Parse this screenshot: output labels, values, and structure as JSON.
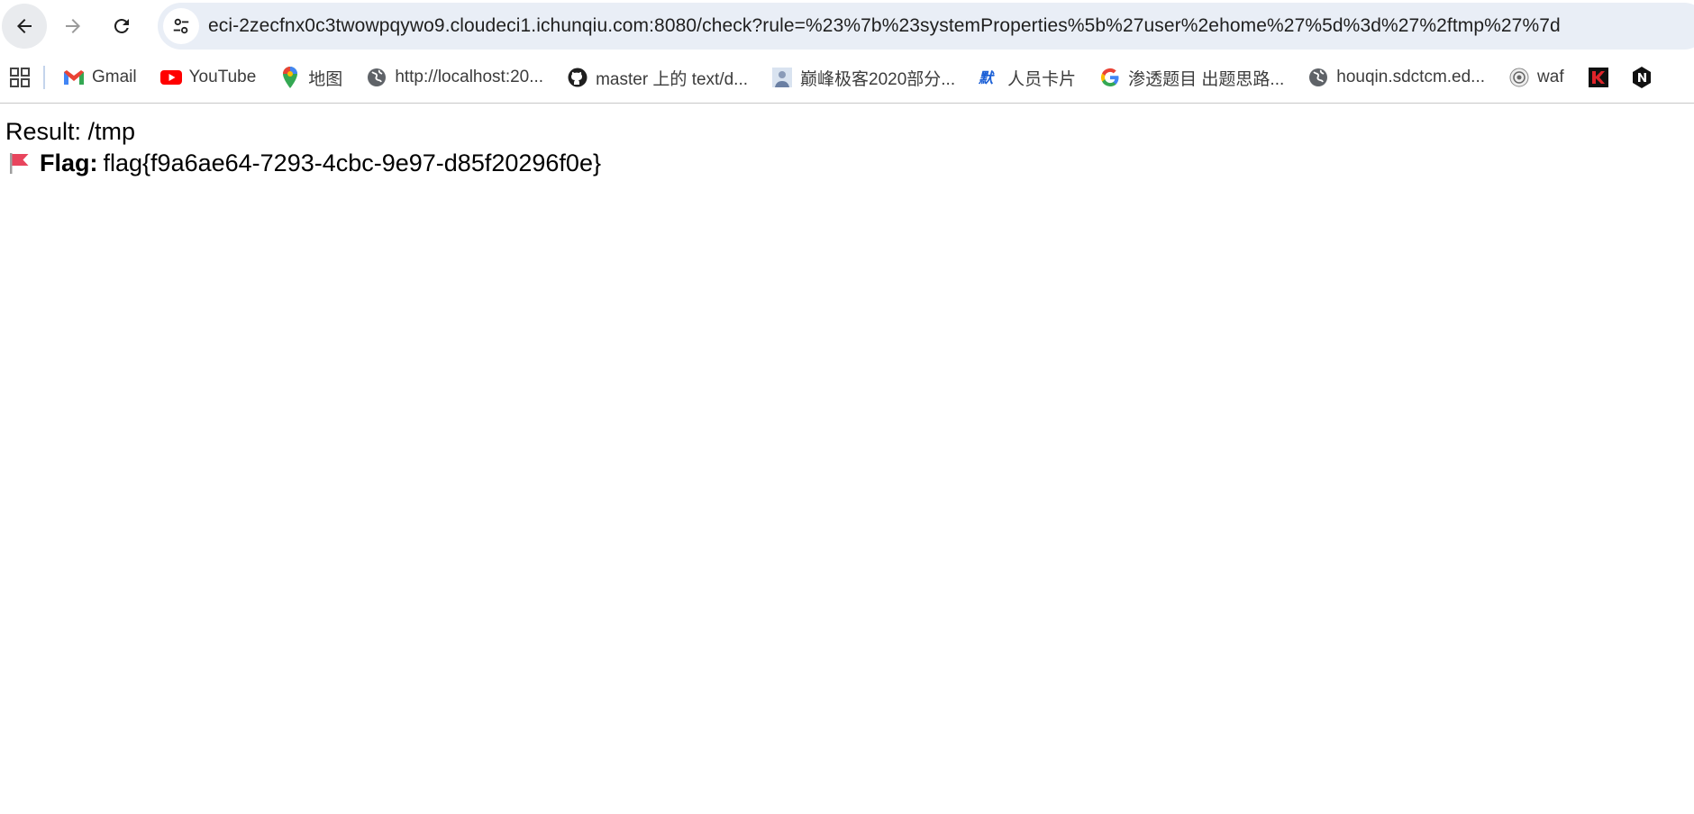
{
  "browser": {
    "url": "eci-2zecfnx0c3twowpqywo9.cloudeci1.ichunqiu.com:8080/check?rule=%23%7b%23systemProperties%5b%27user%2ehome%27%5d%3d%27%2ftmp%27%7d"
  },
  "bookmarks": [
    {
      "label": "Gmail",
      "icon": "gmail-icon"
    },
    {
      "label": "YouTube",
      "icon": "youtube-icon"
    },
    {
      "label": "地图",
      "icon": "maps-icon"
    },
    {
      "label": "http://localhost:20...",
      "icon": "globe-icon"
    },
    {
      "label": "master 上的 text/d...",
      "icon": "github-icon"
    },
    {
      "label": "巅峰极客2020部分...",
      "icon": "avatar-icon"
    },
    {
      "label": "人员卡片",
      "icon": "card-icon"
    },
    {
      "label": "渗透题目 出题思路...",
      "icon": "google-icon"
    },
    {
      "label": "houqin.sdctcm.ed...",
      "icon": "globe-icon"
    },
    {
      "label": "waf",
      "icon": "waf-icon"
    }
  ],
  "page": {
    "result_text": "Result: /tmp",
    "flag_label": "Flag:",
    "flag_value": "flag{f9a6ae64-7293-4cbc-9e97-d85f20296f0e}"
  },
  "colors": {
    "accent_flag": "#e8455d",
    "omnibox_bg": "#e9eef6"
  }
}
